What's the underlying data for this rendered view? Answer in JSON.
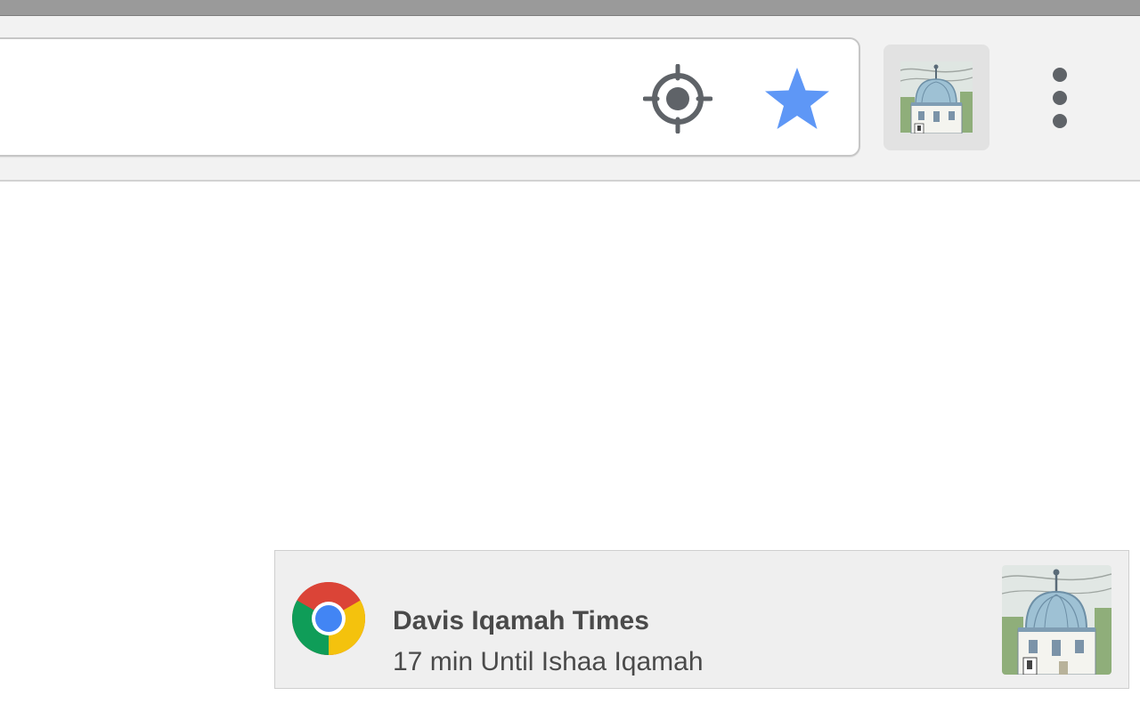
{
  "toolbar": {
    "location_icon": "location-target-icon",
    "bookmark_icon": "star-icon",
    "bookmark_color": "#5e97f6",
    "extension_icon": "mosque-icon",
    "menu_icon": "vertical-dots-icon"
  },
  "notification": {
    "app_icon": "chrome-icon",
    "title": "Davis Iqamah Times",
    "message": "17 min Until Ishaa Iqamah",
    "image_icon": "mosque-icon"
  }
}
